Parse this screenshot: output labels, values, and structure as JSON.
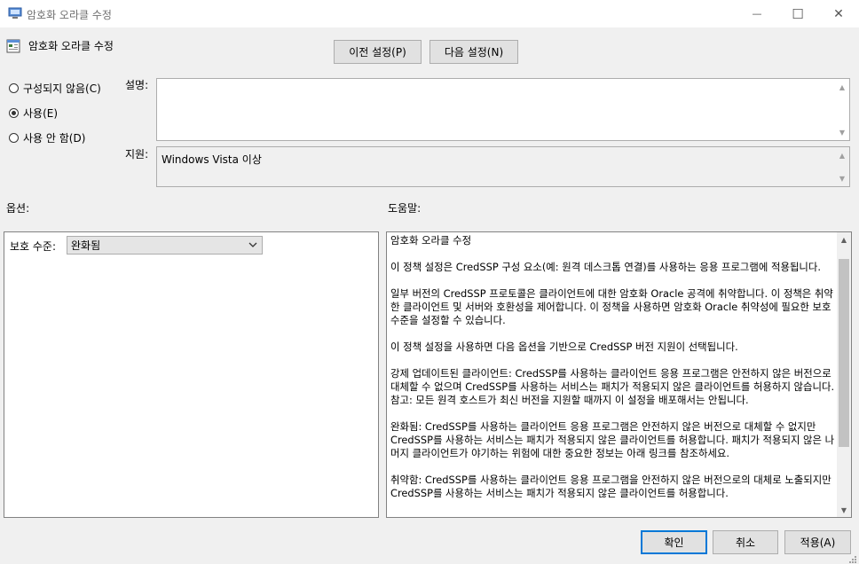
{
  "window": {
    "title": "암호화 오라클 수정",
    "controls": {
      "minimize": "—",
      "maximize": "☐",
      "close": "✕"
    }
  },
  "header": {
    "title": "암호화 오라클 수정"
  },
  "nav": {
    "prev": "이전 설정(P)",
    "next": "다음 설정(N)"
  },
  "state": {
    "options": [
      {
        "label": "구성되지 않음(C)",
        "checked": false
      },
      {
        "label": "사용(E)",
        "checked": true
      },
      {
        "label": "사용 안 함(D)",
        "checked": false
      }
    ]
  },
  "fields": {
    "description_label": "설명:",
    "description_value": "",
    "supported_label": "지원:",
    "supported_value": "Windows Vista 이상"
  },
  "sections": {
    "options_label": "옵션:",
    "help_label": "도움말:"
  },
  "options_panel": {
    "protection_label": "보호 수준:",
    "protection_value": "완화됨"
  },
  "help": {
    "paragraphs": [
      "암호화 오라클 수정",
      "이 정책 설정은 CredSSP 구성 요소(예: 원격 데스크톱 연결)를 사용하는 응용 프로그램에 적용됩니다.",
      "일부 버전의 CredSSP 프로토콜은 클라이언트에 대한 암호화 Oracle 공격에 취약합니다.  이 정책은 취약한 클라이언트 및 서버와 호환성을 제어합니다.  이 정책을 사용하면 암호화 Oracle 취약성에 필요한 보호 수준을 설정할 수 있습니다.",
      "이 정책 설정을 사용하면 다음 옵션을 기반으로 CredSSP 버전 지원이 선택됩니다.",
      "강제 업데이트된 클라이언트: CredSSP를 사용하는 클라이언트 응용 프로그램은 안전하지 않은 버전으로 대체할 수 없으며 CredSSP를 사용하는 서비스는 패치가 적용되지 않은 클라이언트를 허용하지 않습니다. 참고: 모든 원격 호스트가 최신 버전을 지원할 때까지 이 설정을 배포해서는 안됩니다.",
      "완화됨: CredSSP를 사용하는 클라이언트 응용 프로그램은 안전하지 않은 버전으로 대체할 수 없지만 CredSSP를 사용하는 서비스는 패치가 적용되지 않은 클라이언트를 허용합니다. 패치가 적용되지 않은 나머지 클라이언트가 야기하는 위험에 대한 중요한 정보는 아래 링크를 참조하세요.",
      "취약함: CredSSP를 사용하는 클라이언트 응용 프로그램을 안전하지 않은 버전으로의 대체로 노출되지만 CredSSP를 사용하는 서비스는 패치가 적용되지 않은 클라이언트를 허용합니다."
    ]
  },
  "footer": {
    "ok": "확인",
    "cancel": "취소",
    "apply": "적용(A)"
  }
}
